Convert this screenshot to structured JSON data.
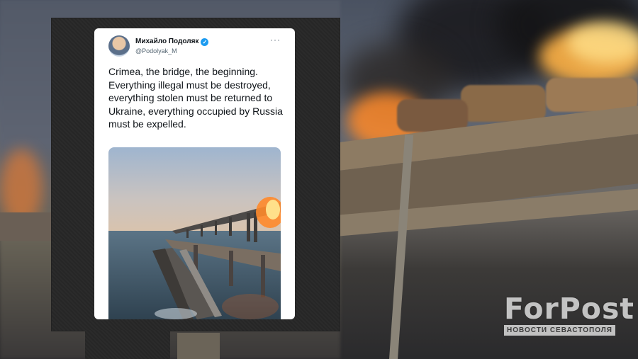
{
  "tweet": {
    "author": "Михайло Подоляк",
    "handle": "@Podolyak_M",
    "more_icon": "more-options-icon",
    "verified_icon": "verified-badge-icon",
    "text": "Crimea, the bridge, the beginning. Everything illegal must be destroyed, everything stolen must be returned to Ukraine, everything occupied by Russia must be expelled."
  },
  "watermark": {
    "name": "ForPost",
    "tagline": "НОВОСТИ СЕВАСТОПОЛЯ"
  }
}
